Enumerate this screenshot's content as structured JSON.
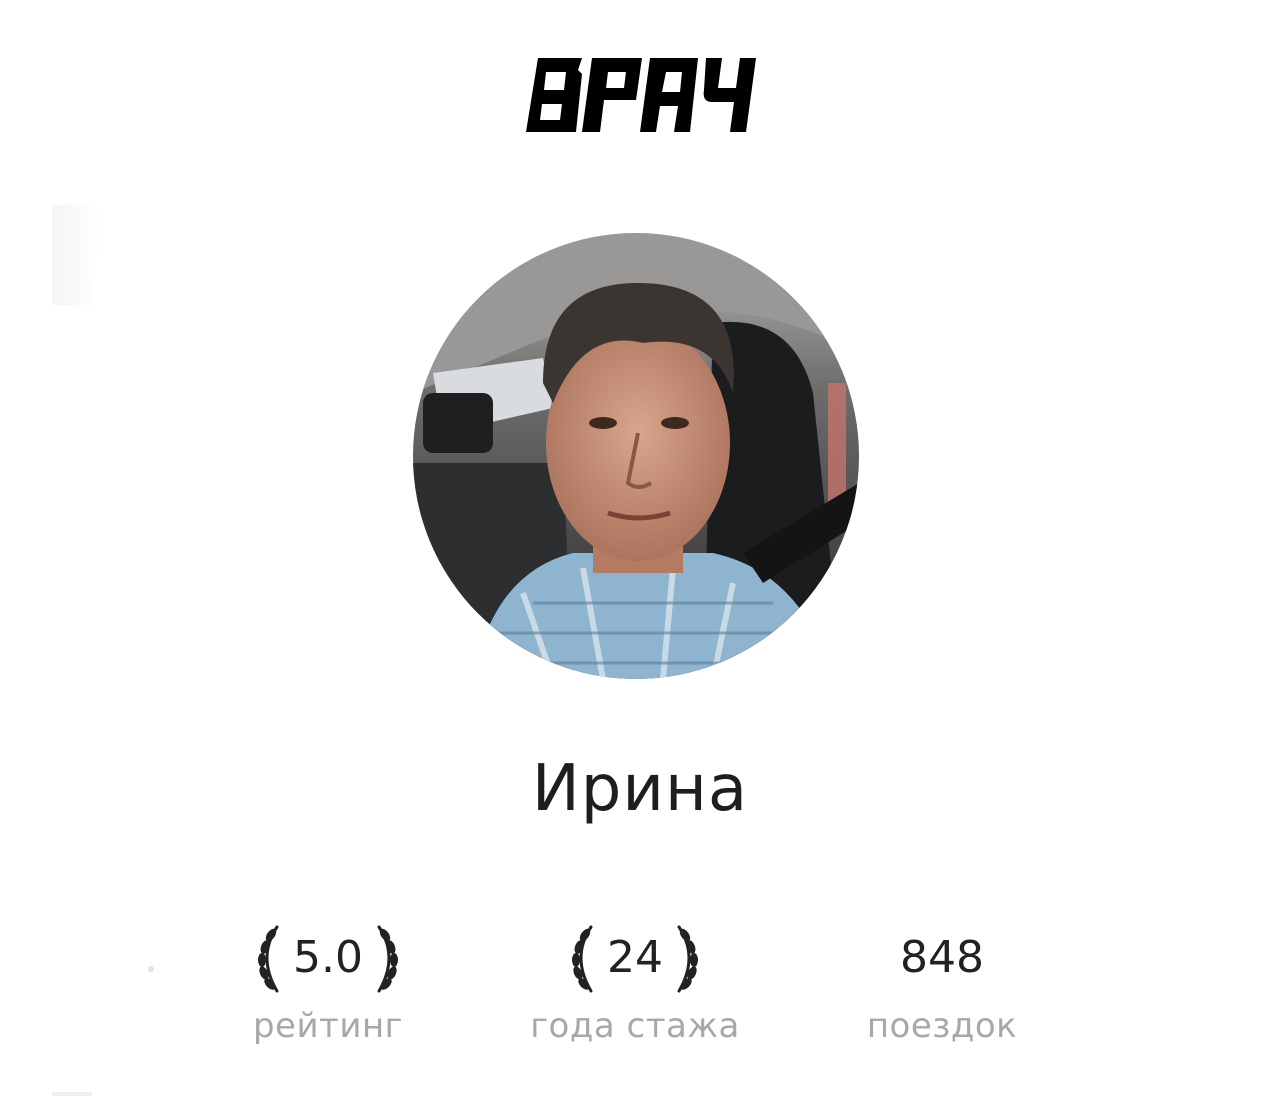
{
  "header": {
    "logo_text": "ВРАЧ"
  },
  "profile": {
    "avatar_alt": "driver-photo",
    "name": "Ирина"
  },
  "stats": [
    {
      "value": "5.0",
      "label": "рейтинг",
      "has_wreath": true
    },
    {
      "value": "24",
      "label": "года стажа",
      "has_wreath": true
    },
    {
      "value": "848",
      "label": "поездок",
      "has_wreath": false
    }
  ],
  "colors": {
    "text_primary": "#1e1e1e",
    "text_secondary": "#a8a8a8",
    "background": "#ffffff"
  }
}
